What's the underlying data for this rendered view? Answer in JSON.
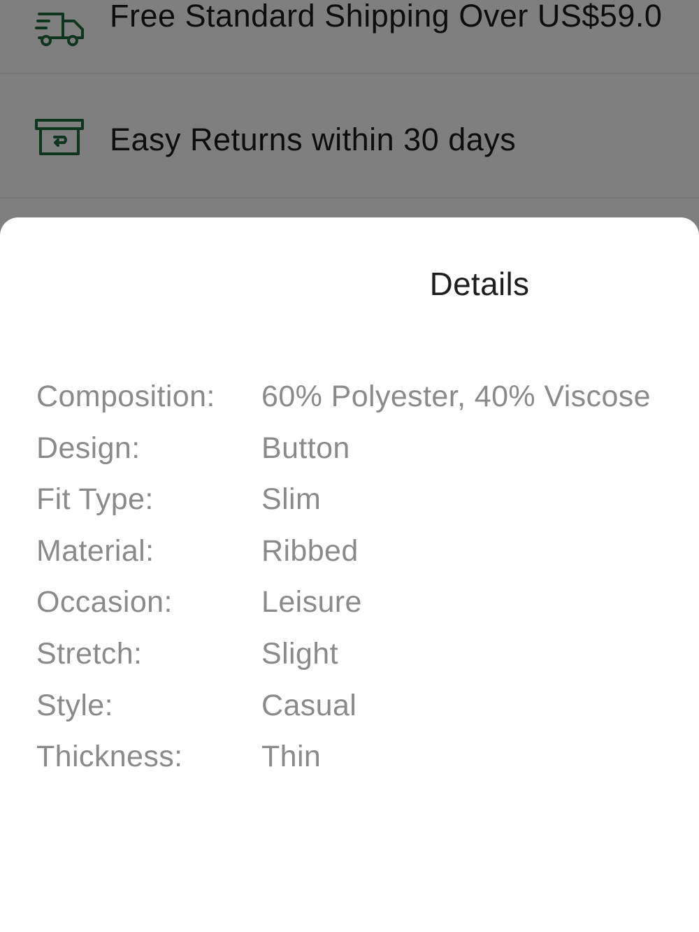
{
  "background": {
    "shipping": {
      "icon": "delivery-truck-icon",
      "text": "Free Standard Shipping Over US$59.0"
    },
    "returns": {
      "icon": "return-box-icon",
      "text": "Easy Returns within 30 days"
    }
  },
  "sheet": {
    "title": "Details",
    "details": [
      {
        "label": "Composition:",
        "value": "60% Polyester, 40% Viscose"
      },
      {
        "label": "Design:",
        "value": "Button"
      },
      {
        "label": "Fit Type:",
        "value": "Slim"
      },
      {
        "label": "Material:",
        "value": "Ribbed"
      },
      {
        "label": "Occasion:",
        "value": "Leisure"
      },
      {
        "label": "Stretch:",
        "value": "Slight"
      },
      {
        "label": "Style:",
        "value": "Casual"
      },
      {
        "label": "Thickness:",
        "value": "Thin"
      }
    ]
  },
  "colors": {
    "icon_green": "#1f6b3c",
    "scrim": "rgba(0,0,0,0.5)",
    "label_gray": "#8a8a8a",
    "title": "#1e1e1e"
  }
}
